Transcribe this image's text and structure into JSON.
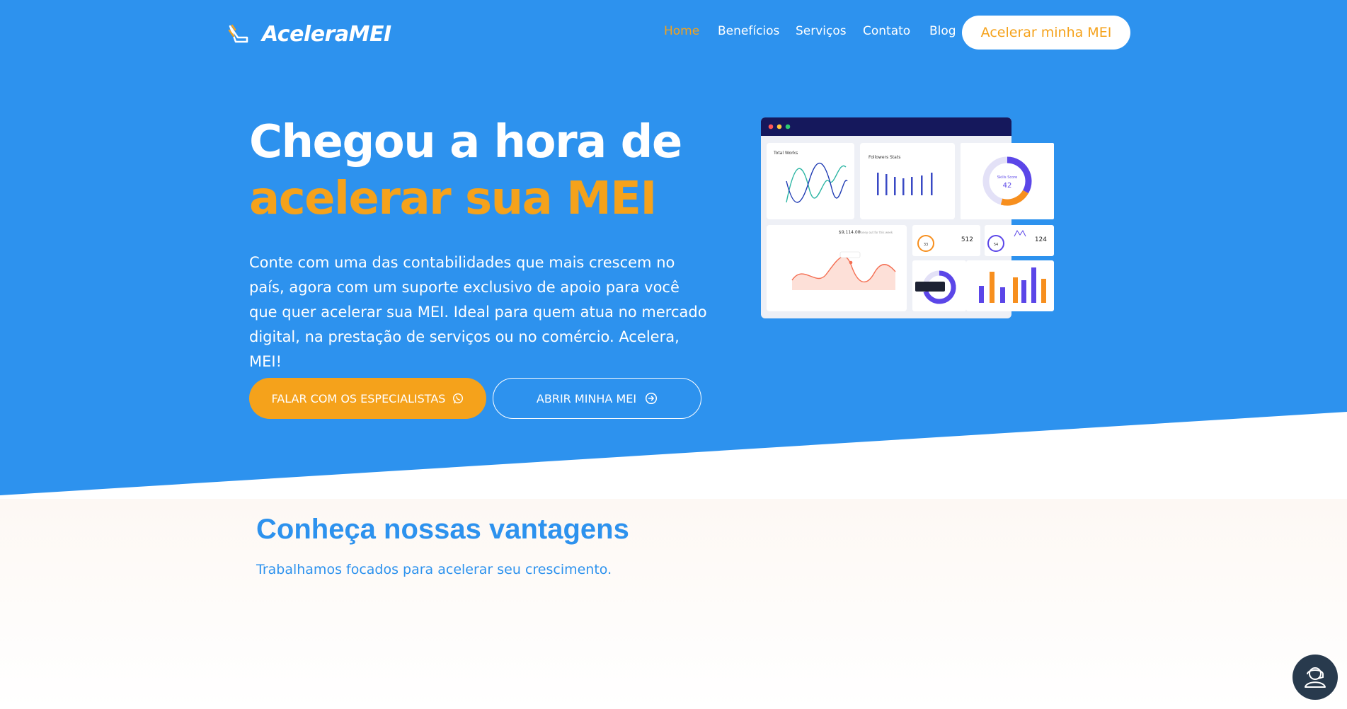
{
  "header": {
    "logo_text": "AceleraMEI",
    "nav": [
      {
        "label": "Home",
        "active": true
      },
      {
        "label": "Benefícios",
        "active": false
      },
      {
        "label": "Serviços",
        "active": false
      },
      {
        "label": "Contato",
        "active": false
      },
      {
        "label": "Blog",
        "active": false
      }
    ],
    "cta_label": "Acelerar minha MEI"
  },
  "hero": {
    "title_line1": "Chegou a hora de",
    "title_line2": "acelerar sua MEI",
    "lead": "Conte com uma das contabilidades que mais crescem no país, agora com um suporte exclusivo de apoio para você que quer acelerar sua MEI.  Ideal para quem atua no mercado digital, na prestação de serviços ou no comércio. Acelera, MEI!",
    "primary_button": "FALAR COM OS ESPECIALISTAS",
    "secondary_button": "ABRIR MINHA MEI"
  },
  "dashboard": {
    "total_works_label": "Total Works",
    "followers_label": "Followers Stats",
    "skills_label": "Skills Score",
    "skills_value": "42",
    "money_value": "$9,114.00",
    "money_caption": "Money out for this week",
    "card_a_value": "512",
    "card_b_value": "124",
    "card_a_inner": "33",
    "card_b_inner": "54"
  },
  "section2": {
    "title": "Conheça nossas vantagens",
    "subtitle": "Trabalhamos focados para acelerar seu crescimento."
  },
  "colors": {
    "brand_blue": "#2d92ee",
    "accent_orange": "#f5a21b",
    "dark": "#283a4d"
  }
}
